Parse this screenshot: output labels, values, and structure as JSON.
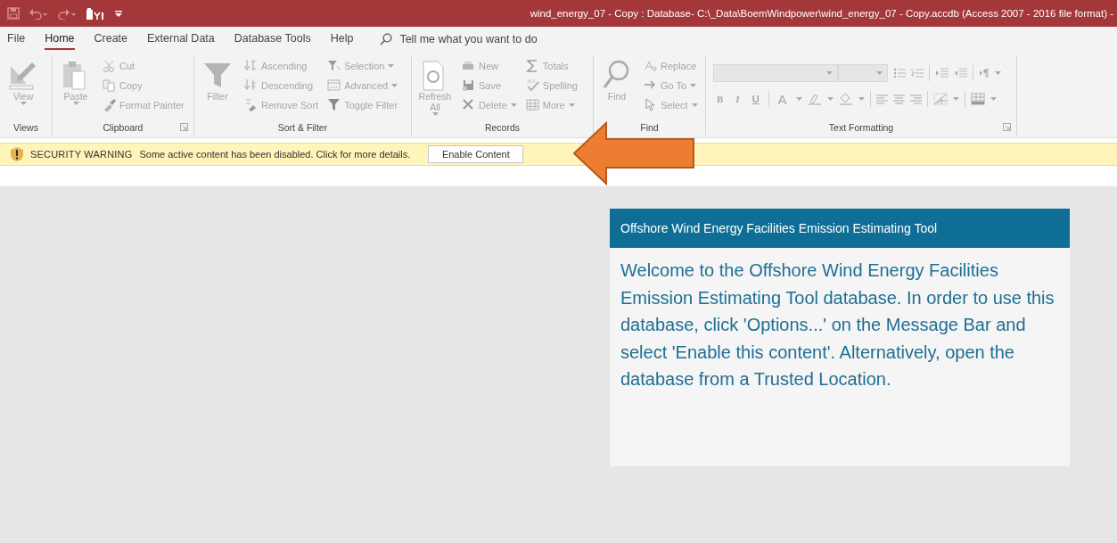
{
  "title_bar": {
    "title": "wind_energy_07 - Copy : Database- C:\\_Data\\BoemWindpower\\wind_energy_07 - Copy.accdb (Access 2007 - 2016 file format)  -"
  },
  "menu_tabs": [
    {
      "label": "File",
      "selected": false
    },
    {
      "label": "Home",
      "selected": true
    },
    {
      "label": "Create",
      "selected": false
    },
    {
      "label": "External Data",
      "selected": false
    },
    {
      "label": "Database Tools",
      "selected": false
    },
    {
      "label": "Help",
      "selected": false
    }
  ],
  "tell_me": {
    "placeholder": "Tell me what you want to do"
  },
  "ribbon_groups": [
    {
      "label": "Views",
      "launcher": false,
      "large": [
        {
          "label": "View",
          "dropdown": true,
          "disabled": true
        }
      ]
    },
    {
      "label": "Clipboard",
      "launcher": true,
      "large": [
        {
          "label": "Paste",
          "dropdown": true,
          "disabled": true
        }
      ],
      "columns": [
        [
          {
            "label": "Cut",
            "dropdown": false,
            "disabled": true
          },
          {
            "label": "Copy",
            "dropdown": false,
            "disabled": true
          },
          {
            "label": "Format Painter",
            "dropdown": false,
            "disabled": true
          }
        ]
      ]
    },
    {
      "label": "Sort & Filter",
      "launcher": false,
      "large": [
        {
          "label": "Filter",
          "dropdown": false,
          "disabled": true
        }
      ],
      "columns": [
        [
          {
            "label": "Ascending",
            "dropdown": false,
            "disabled": true
          },
          {
            "label": "Descending",
            "dropdown": false,
            "disabled": true
          },
          {
            "label": "Remove Sort",
            "dropdown": false,
            "disabled": true
          }
        ],
        [
          {
            "label": "Selection",
            "dropdown": true,
            "disabled": true
          },
          {
            "label": "Advanced",
            "dropdown": true,
            "disabled": true
          },
          {
            "label": "Toggle Filter",
            "dropdown": false,
            "disabled": true
          }
        ]
      ]
    },
    {
      "label": "Records",
      "launcher": false,
      "large": [
        {
          "label": "Refresh All",
          "dropdown": true,
          "disabled": true
        }
      ],
      "columns": [
        [
          {
            "label": "New",
            "dropdown": false,
            "disabled": true
          },
          {
            "label": "Save",
            "dropdown": false,
            "disabled": true
          },
          {
            "label": "Delete",
            "dropdown": true,
            "disabled": true
          }
        ],
        [
          {
            "label": "Totals",
            "dropdown": false,
            "disabled": true
          },
          {
            "label": "Spelling",
            "dropdown": false,
            "disabled": true
          },
          {
            "label": "More",
            "dropdown": true,
            "disabled": true
          }
        ]
      ]
    },
    {
      "label": "Find",
      "launcher": false,
      "large": [
        {
          "label": "Find",
          "dropdown": false,
          "disabled": true
        }
      ],
      "columns": [
        [
          {
            "label": "Replace",
            "dropdown": false,
            "disabled": true
          },
          {
            "label": "Go To",
            "dropdown": true,
            "disabled": true
          },
          {
            "label": "Select",
            "dropdown": true,
            "disabled": true
          }
        ]
      ]
    },
    {
      "label": "Text Formatting",
      "launcher": true
    }
  ],
  "text_formatting": {
    "format_letters": [
      {
        "label": "B",
        "disabled": true
      },
      {
        "label": "I",
        "disabled": true
      },
      {
        "label": "U",
        "disabled": true
      },
      {
        "label": "A",
        "disabled": true
      }
    ]
  },
  "message_bar": {
    "heading": "SECURITY WARNING",
    "message": "Some active content has been disabled. Click for more details.",
    "button": "Enable Content"
  },
  "welcome_panel": {
    "title": "Offshore Wind Energy Facilities Emission Estimating Tool",
    "message": "Welcome to the Offshore Wind Energy Facilities Emission Estimating Tool database. In order to use this database, click 'Options...' on the Message Bar and select 'Enable this content'. Alternatively, open the database from a Trusted Location."
  }
}
